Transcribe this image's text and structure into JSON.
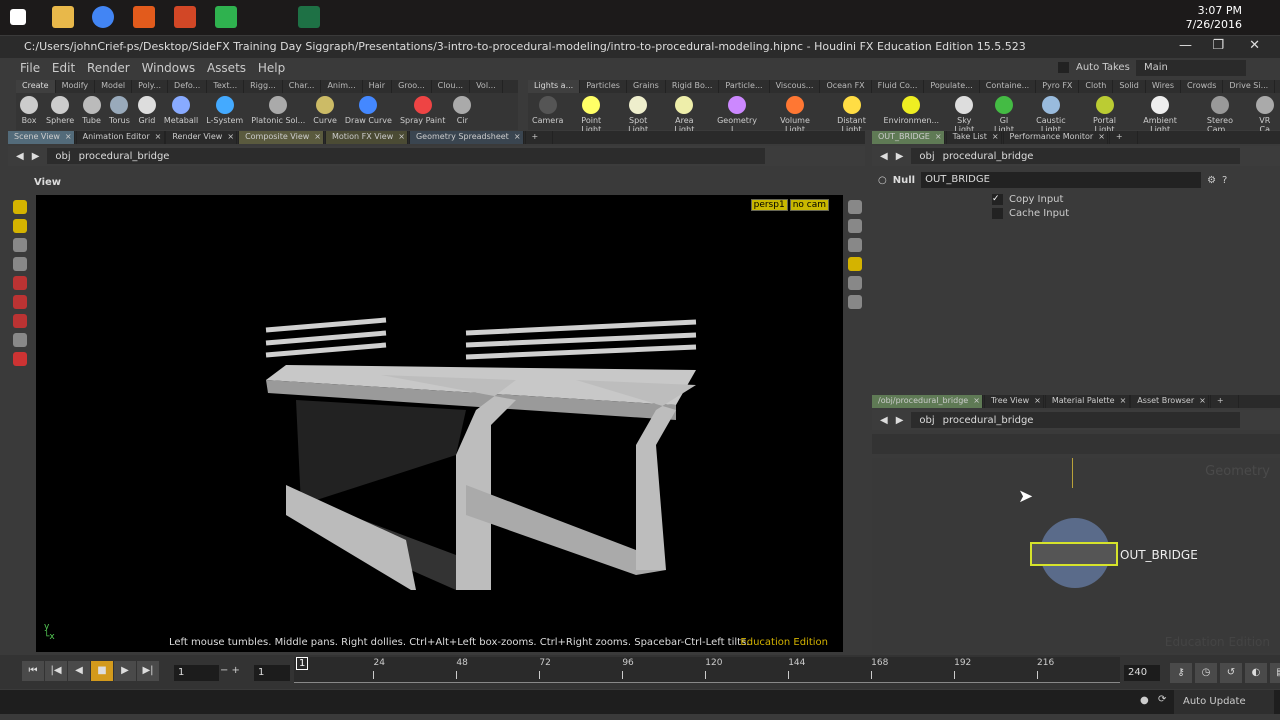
{
  "taskbar": {
    "time": "3:07 PM",
    "date": "7/26/2016"
  },
  "window": {
    "title": "C:/Users/johnCrief-ps/Desktop/SideFX Training Day Siggraph/Presentations/3-intro-to-procedural-modeling/intro-to-procedural-modeling.hipnc - Houdini FX Education Edition 15.5.523"
  },
  "menu": [
    "File",
    "Edit",
    "Render",
    "Windows",
    "Assets",
    "Help"
  ],
  "desktop": {
    "auto_takes": "Auto Takes",
    "desktop": "Main"
  },
  "shelf_left": {
    "tabs": [
      "Create",
      "Modify",
      "Model",
      "Poly...",
      "Defo...",
      "Text...",
      "Rigg...",
      "Char...",
      "Anim...",
      "Hair",
      "Groo...",
      "Clou...",
      "Vol..."
    ],
    "tools": [
      "Box",
      "Sphere",
      "Tube",
      "Torus",
      "Grid",
      "Metaball",
      "L-System",
      "Platonic Sol...",
      "Curve",
      "Draw Curve",
      "Spray Paint",
      "Cir"
    ]
  },
  "shelf_right": {
    "tabs": [
      "Lights a...",
      "Particles",
      "Grains",
      "Rigid Bo...",
      "Particle...",
      "Viscous...",
      "Ocean FX",
      "Fluid Co...",
      "Populate...",
      "Containe...",
      "Pyro FX",
      "Cloth",
      "Solid",
      "Wires",
      "Crowds",
      "Drive Si..."
    ],
    "tools": [
      "Camera",
      "Point Light",
      "Spot Light",
      "Area Light",
      "Geometry L...",
      "Volume Light",
      "Distant Light",
      "Environmen...",
      "Sky Light",
      "GI Light",
      "Caustic Light",
      "Portal Light",
      "Ambient Light",
      "Stereo Cam...",
      "VR Ca"
    ]
  },
  "left_pane": {
    "tabs": [
      "Scene View",
      "Animation Editor",
      "Render View",
      "Composite View",
      "Motion FX View",
      "Geometry Spreadsheet"
    ],
    "path": [
      "obj",
      "procedural_bridge"
    ],
    "view_label": "View",
    "cam": "persp1",
    "nocam": "no cam",
    "hint": "Left mouse tumbles. Middle pans. Right dollies. Ctrl+Alt+Left box-zooms. Ctrl+Right zooms. Spacebar-Ctrl-Left tilts.",
    "edition": "Education Edition"
  },
  "param_pane": {
    "tabs": [
      "OUT_BRIDGE",
      "Take List",
      "Performance Monitor"
    ],
    "path": [
      "obj",
      "procedural_bridge"
    ],
    "node_type": "Null",
    "node_name": "OUT_BRIDGE",
    "copy_input": "Copy Input",
    "cache_input": "Cache Input"
  },
  "network_pane": {
    "tabs": [
      "/obj/procedural_bridge",
      "Tree View",
      "Material Palette",
      "Asset Browser"
    ],
    "path": [
      "obj",
      "procedural_bridge"
    ],
    "watermark": "Geometry",
    "edition": "Education Edition",
    "node_label": "OUT_BRIDGE"
  },
  "timeline": {
    "current_frame": "1",
    "start_frame": "1",
    "end_frame": "240",
    "marker": "1",
    "ticks": [
      "24",
      "48",
      "72",
      "96",
      "120",
      "144",
      "168",
      "192",
      "216"
    ]
  },
  "status": {
    "auto_update": "Auto Update"
  }
}
